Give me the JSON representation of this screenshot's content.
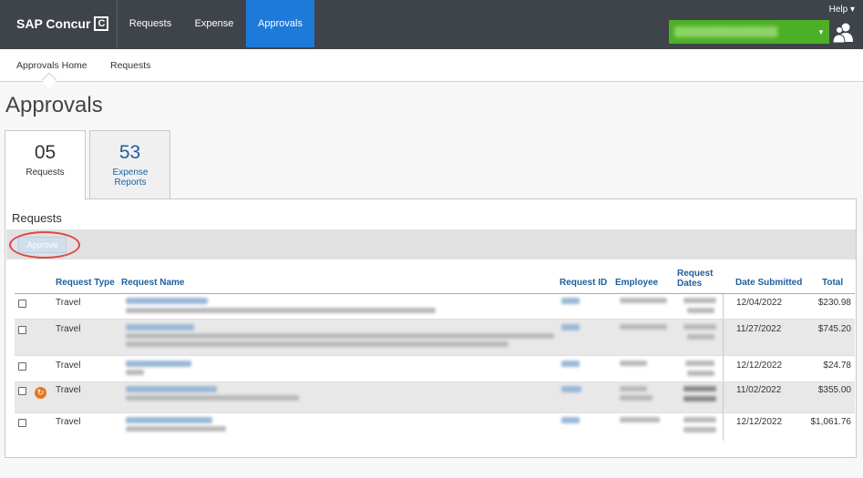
{
  "header": {
    "logo_text": "SAP Concur",
    "logo_mark": "C",
    "nav": [
      "Requests",
      "Expense",
      "Approvals"
    ],
    "help": "Help ▾",
    "user_caret": "▾"
  },
  "subnav": [
    "Approvals Home",
    "Requests"
  ],
  "page_title": "Approvals",
  "tabs": [
    {
      "count": "05",
      "label": "Requests"
    },
    {
      "count": "53",
      "label": "Expense Reports"
    }
  ],
  "panel": {
    "title": "Requests",
    "approve_label": "Approve"
  },
  "table": {
    "headers": [
      "Request Type",
      "Request Name",
      "Request ID",
      "Employee",
      "Request Dates",
      "Date Submitted",
      "Total"
    ],
    "rows": [
      {
        "type": "Travel",
        "date_submitted": "12/04/2022",
        "total": "$230.98",
        "icon": false
      },
      {
        "type": "Travel",
        "date_submitted": "11/27/2022",
        "total": "$745.20",
        "icon": false
      },
      {
        "type": "Travel",
        "date_submitted": "12/12/2022",
        "total": "$24.78",
        "icon": false
      },
      {
        "type": "Travel",
        "date_submitted": "11/02/2022",
        "total": "$355.00",
        "icon": true
      },
      {
        "type": "Travel",
        "date_submitted": "12/12/2022",
        "total": "$1,061.76",
        "icon": false
      }
    ]
  },
  "colors": {
    "topbar": "#3e4449",
    "active_nav": "#1d7ad9",
    "user_box": "#4caf25",
    "link": "#1d5f9e",
    "highlight_ring": "#e04545"
  }
}
